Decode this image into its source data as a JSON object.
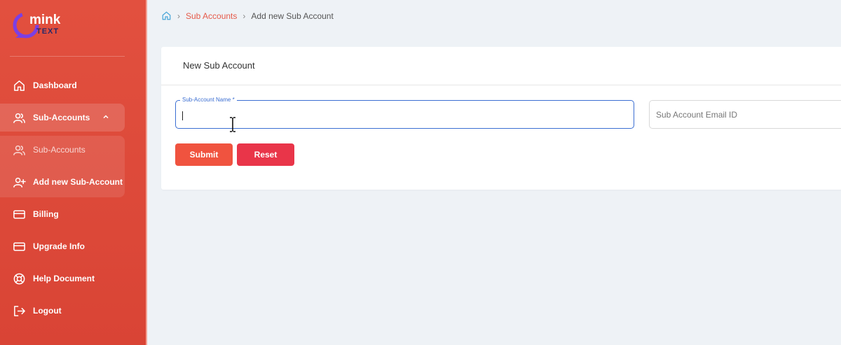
{
  "brand": {
    "logo_text_top": "mink",
    "logo_text_bottom": "TEXT"
  },
  "sidebar": {
    "items": [
      {
        "label": "Dashboard",
        "icon": "home-icon"
      },
      {
        "label": "Sub-Accounts",
        "icon": "users-icon",
        "expanded": true
      },
      {
        "label": "Sub-Accounts",
        "icon": "users-icon"
      },
      {
        "label": "Add new Sub-Account",
        "icon": "user-plus-icon"
      },
      {
        "label": "Billing",
        "icon": "card-icon"
      },
      {
        "label": "Upgrade Info",
        "icon": "card-icon"
      },
      {
        "label": "Help Document",
        "icon": "lifebuoy-icon"
      },
      {
        "label": "Logout",
        "icon": "logout-icon"
      }
    ]
  },
  "breadcrumb": {
    "home_icon": "home-icon",
    "link": "Sub Accounts",
    "current": "Add new Sub Account"
  },
  "form": {
    "title": "New Sub Account",
    "name_label": "Sub-Account Name *",
    "name_value": "",
    "email_placeholder": "Sub Account Email ID",
    "submit_label": "Submit",
    "reset_label": "Reset"
  },
  "colors": {
    "sidebar": "#e2503f",
    "accent": "#e65a4a",
    "focus": "#3b6ed2",
    "submit": "#f0533f",
    "reset": "#e93549"
  }
}
